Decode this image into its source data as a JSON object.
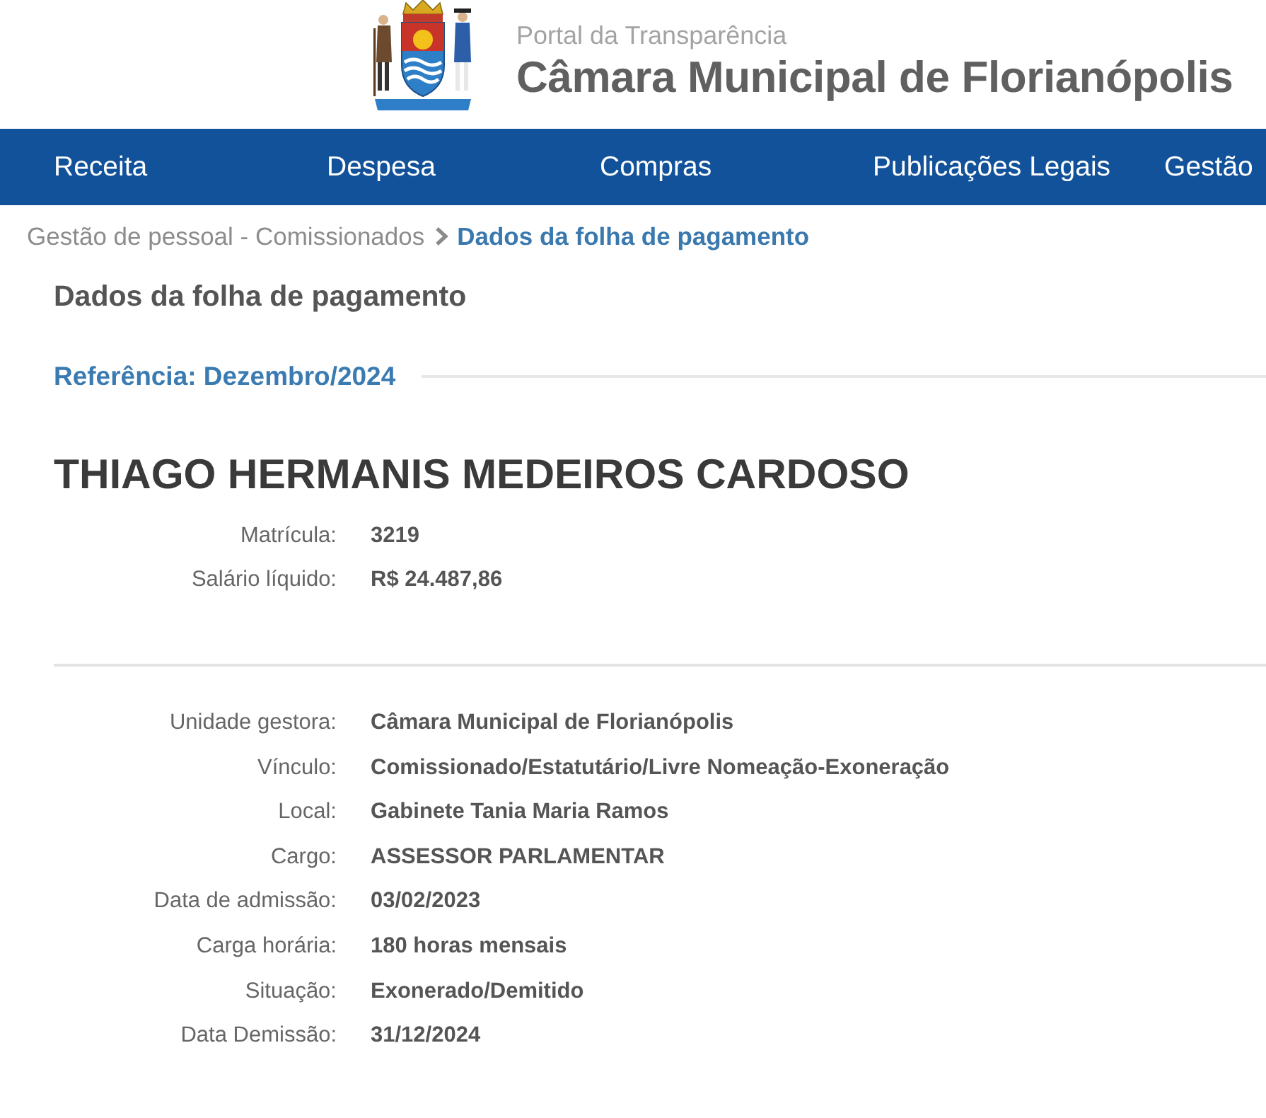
{
  "header": {
    "subtitle": "Portal da Transparência",
    "title": "Câmara Municipal de Florianópolis"
  },
  "nav": {
    "items": [
      {
        "label": "Receita"
      },
      {
        "label": "Despesa"
      },
      {
        "label": "Compras"
      },
      {
        "label": "Publicações Legais"
      },
      {
        "label": "Gestão"
      }
    ]
  },
  "breadcrumb": [
    {
      "label": "Gestão de pessoal - Comissionados",
      "current": false
    },
    {
      "label": "Dados da folha de pagamento",
      "current": true
    }
  ],
  "page_title": "Dados da folha de pagamento",
  "reference": "Referência: Dezembro/2024",
  "employee": {
    "name": "THIAGO HERMANIS MEDEIROS CARDOSO",
    "summary": [
      {
        "label": "Matrícula:",
        "value": "3219"
      },
      {
        "label": "Salário líquido:",
        "value": "R$ 24.487,86"
      }
    ],
    "details": [
      {
        "label": "Unidade gestora:",
        "value": "Câmara Municipal de Florianópolis"
      },
      {
        "label": "Vínculo:",
        "value": "Comissionado/Estatutário/Livre Nomeação-Exoneração"
      },
      {
        "label": "Local:",
        "value": "Gabinete Tania Maria Ramos"
      },
      {
        "label": "Cargo:",
        "value": "ASSESSOR PARLAMENTAR"
      },
      {
        "label": "Data de admissão:",
        "value": "03/02/2023"
      },
      {
        "label": "Carga horária:",
        "value": "180 horas mensais"
      },
      {
        "label": "Situação:",
        "value": "Exonerado/Demitido"
      },
      {
        "label": "Data Demissão:",
        "value": "31/12/2024"
      }
    ]
  }
}
